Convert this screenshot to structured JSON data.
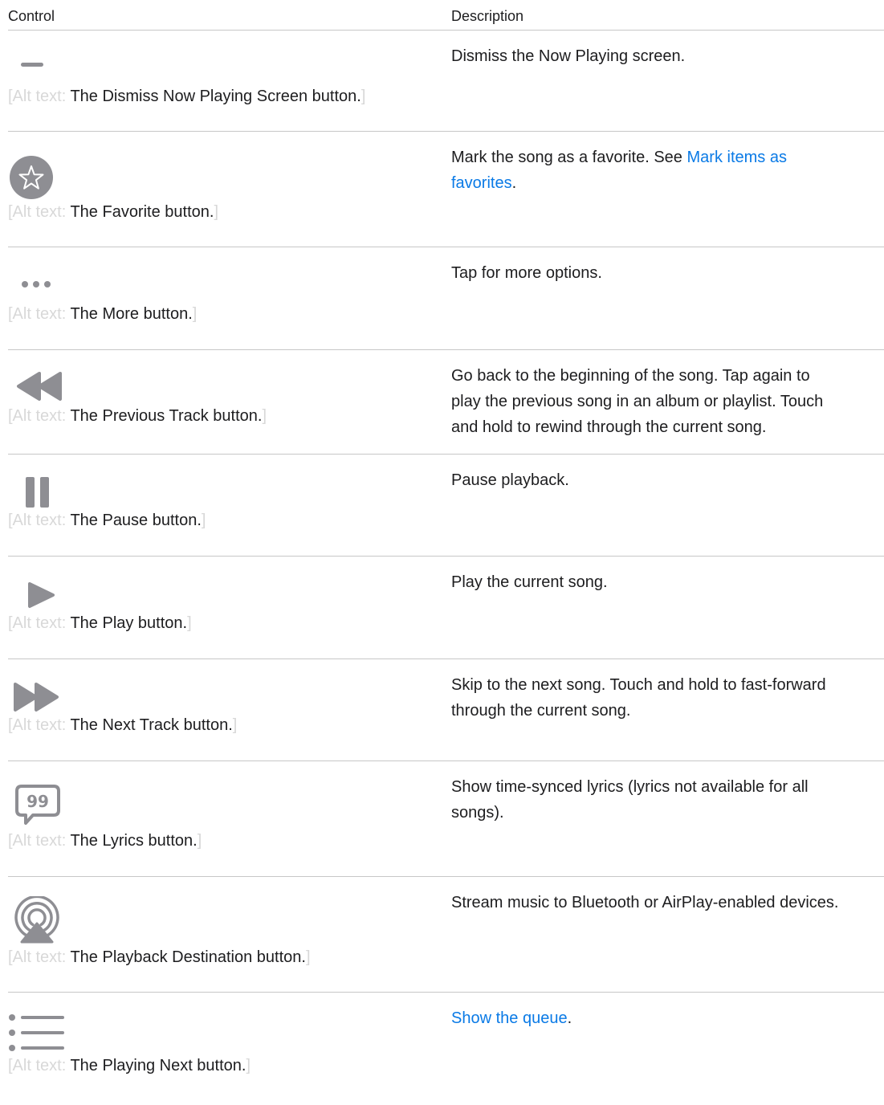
{
  "header": {
    "col_control": "Control",
    "col_description": "Description"
  },
  "alt_prefix": "[Alt text: ",
  "alt_suffix": "]",
  "colors": {
    "link": "#0a7ae6",
    "icon": "#8e8e93",
    "rule": "#c7c7c7",
    "alt_bracket": "#d8d8d8"
  },
  "rows": [
    {
      "icon": "dismiss-icon",
      "alt": "The Dismiss Now Playing Screen button.",
      "desc": "Dismiss the Now Playing screen."
    },
    {
      "icon": "favorite-star-icon",
      "alt": "The Favorite button.",
      "desc_pre": "Mark the song as a favorite. See ",
      "link_a": "Mark items as",
      "link_b": "favorites",
      "desc_post": "."
    },
    {
      "icon": "more-icon",
      "alt": "The More button.",
      "desc": "Tap for more options."
    },
    {
      "icon": "previous-track-icon",
      "alt": "The Previous Track button.",
      "desc_lines": [
        "Go back to the beginning of the song. Tap again to",
        "play the previous song in an album or playlist. Touch",
        "and hold to rewind through the current song."
      ]
    },
    {
      "icon": "pause-icon",
      "alt": "The Pause button.",
      "desc": "Pause playback."
    },
    {
      "icon": "play-icon",
      "alt": "The Play button.",
      "desc": "Play the current song."
    },
    {
      "icon": "next-track-icon",
      "alt": "The Next Track button.",
      "desc_lines": [
        "Skip to the next song. Touch and hold to fast-forward",
        "through the current song."
      ]
    },
    {
      "icon": "lyrics-icon",
      "alt": "The Lyrics button.",
      "desc_lines": [
        "Show time-synced lyrics (lyrics not available for all",
        "songs)."
      ]
    },
    {
      "icon": "airplay-icon",
      "alt": "The Playback Destination button.",
      "desc": "Stream music to Bluetooth or AirPlay-enabled devices."
    },
    {
      "icon": "playing-next-list-icon",
      "alt": "The Playing Next button.",
      "desc_link": "Show the queue",
      "desc_post": "."
    }
  ]
}
